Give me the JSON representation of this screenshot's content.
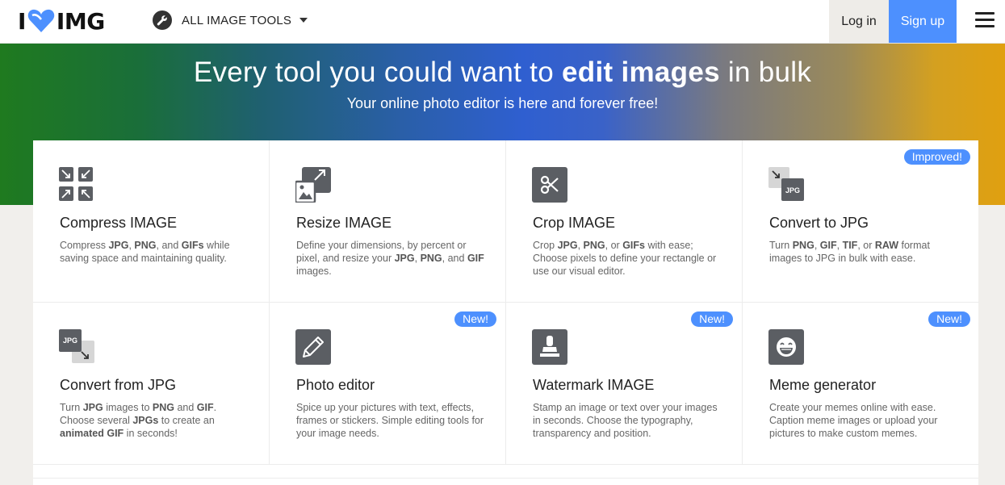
{
  "header": {
    "logo_left": "I",
    "logo_right": "IMG",
    "tools_label": "ALL IMAGE TOOLS",
    "login_label": "Log in",
    "signup_label": "Sign up"
  },
  "hero": {
    "title_pre": "Every tool you could want to ",
    "title_bold": "edit images",
    "title_post": " in bulk",
    "subtitle": "Your online photo editor is here and forever free!"
  },
  "colors": {
    "accent": "#4d90fe",
    "icon_bg": "#5b5e63"
  },
  "tools": [
    {
      "title": "Compress IMAGE",
      "icon": "compress-icon",
      "badge": "",
      "desc": [
        {
          "t": "Compress "
        },
        {
          "b": "JPG"
        },
        {
          "t": ", "
        },
        {
          "b": "PNG"
        },
        {
          "t": ", and "
        },
        {
          "b": "GIFs"
        },
        {
          "t": " while saving space and maintaining quality."
        }
      ]
    },
    {
      "title": "Resize IMAGE",
      "icon": "resize-icon",
      "badge": "",
      "desc": [
        {
          "t": "Define your dimensions, by percent or pixel, and resize your "
        },
        {
          "b": "JPG"
        },
        {
          "t": ", "
        },
        {
          "b": "PNG"
        },
        {
          "t": ", and "
        },
        {
          "b": "GIF"
        },
        {
          "t": " images."
        }
      ]
    },
    {
      "title": "Crop IMAGE",
      "icon": "crop-icon",
      "badge": "",
      "desc": [
        {
          "t": "Crop "
        },
        {
          "b": "JPG"
        },
        {
          "t": ", "
        },
        {
          "b": "PNG"
        },
        {
          "t": ", or "
        },
        {
          "b": "GIFs"
        },
        {
          "t": " with ease; Choose pixels to define your rectangle or use our visual editor."
        }
      ]
    },
    {
      "title": "Convert to JPG",
      "icon": "convert-to-jpg-icon",
      "badge": "Improved!",
      "desc": [
        {
          "t": "Turn "
        },
        {
          "b": "PNG"
        },
        {
          "t": ", "
        },
        {
          "b": "GIF"
        },
        {
          "t": ", "
        },
        {
          "b": "TIF"
        },
        {
          "t": ", or "
        },
        {
          "b": "RAW"
        },
        {
          "t": " format images to JPG in bulk with ease."
        }
      ]
    },
    {
      "title": "Convert from JPG",
      "icon": "convert-from-jpg-icon",
      "badge": "",
      "desc": [
        {
          "t": "Turn "
        },
        {
          "b": "JPG"
        },
        {
          "t": " images to "
        },
        {
          "b": "PNG"
        },
        {
          "t": " and "
        },
        {
          "b": "GIF"
        },
        {
          "t": ". Choose several "
        },
        {
          "b": "JPGs"
        },
        {
          "t": " to create an "
        },
        {
          "b": "animated GIF"
        },
        {
          "t": " in seconds!"
        }
      ]
    },
    {
      "title": "Photo editor",
      "icon": "pencil-icon",
      "badge": "New!",
      "desc": [
        {
          "t": "Spice up your pictures with text, effects, frames or stickers. Simple editing tools for your image needs."
        }
      ]
    },
    {
      "title": "Watermark IMAGE",
      "icon": "stamp-icon",
      "badge": "New!",
      "desc": [
        {
          "t": "Stamp an image or text over your images in seconds. Choose the typography, transparency and position."
        }
      ]
    },
    {
      "title": "Meme generator",
      "icon": "smiley-icon",
      "badge": "New!",
      "desc": [
        {
          "t": "Create your memes online with ease. Caption meme images or upload your pictures to make custom memes."
        }
      ]
    }
  ],
  "jpg_label": "JPG"
}
